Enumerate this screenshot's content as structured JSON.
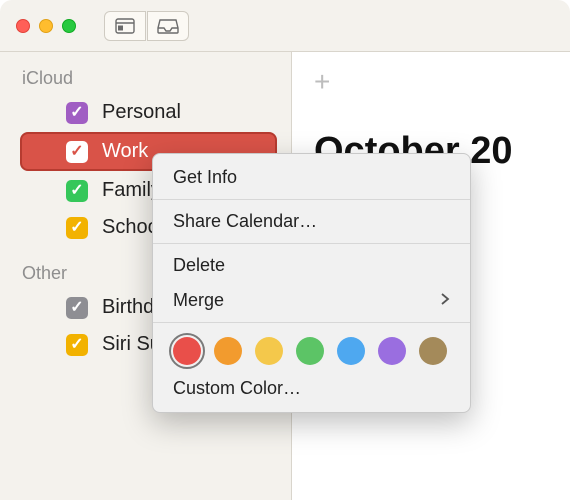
{
  "titlebar": {
    "traffic": {
      "close": "close",
      "minimize": "minimize",
      "zoom": "zoom"
    }
  },
  "sidebar": {
    "sections": [
      {
        "label": "iCloud",
        "items": [
          {
            "label": "Personal",
            "color": "#a05ec3",
            "checked": true,
            "selected": false
          },
          {
            "label": "Work",
            "color": "#d95348",
            "checked": true,
            "selected": true
          },
          {
            "label": "Family",
            "color": "#35c75a",
            "checked": true,
            "selected": false
          },
          {
            "label": "School",
            "color": "#f2b200",
            "checked": true,
            "selected": false
          }
        ]
      },
      {
        "label": "Other",
        "items": [
          {
            "label": "Birthdays",
            "color": "#8e8e93",
            "checked": true,
            "selected": false
          },
          {
            "label": "Siri Su",
            "color": "#f2b200",
            "checked": true,
            "selected": false
          }
        ]
      }
    ]
  },
  "main": {
    "title": "October 20",
    "add": "+"
  },
  "context_menu": {
    "get_info": "Get Info",
    "share": "Share Calendar…",
    "delete": "Delete",
    "merge": "Merge",
    "custom_color": "Custom Color…",
    "colors": [
      {
        "hex": "#e94f4a",
        "selected": true
      },
      {
        "hex": "#f29b2e",
        "selected": false
      },
      {
        "hex": "#f4c84b",
        "selected": false
      },
      {
        "hex": "#5cc466",
        "selected": false
      },
      {
        "hex": "#4ea8f0",
        "selected": false
      },
      {
        "hex": "#9a6ee0",
        "selected": false
      },
      {
        "hex": "#a48a5a",
        "selected": false
      }
    ]
  }
}
